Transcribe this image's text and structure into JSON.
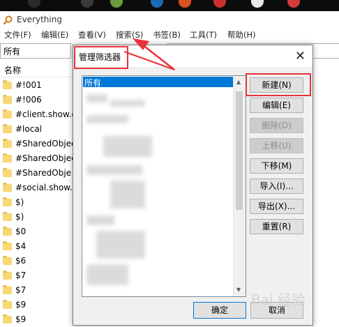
{
  "app": {
    "title": "Everything"
  },
  "menu": [
    "文件(F)",
    "编辑(E)",
    "查看(V)",
    "搜索(S)",
    "书签(B)",
    "工具(T)",
    "帮助(H)"
  ],
  "filter": {
    "current": "所有"
  },
  "list": {
    "header": "名称",
    "items": [
      "#!001",
      "#!006",
      "#client.show.q",
      "#local",
      "#SharedObjec",
      "#SharedObjec",
      "#SharedObje",
      "#social.show.q",
      "$)",
      "$)",
      "$0",
      "$4",
      "$6",
      "$7",
      "$7",
      "$9",
      "$9"
    ]
  },
  "dialog": {
    "title": "管理筛选器",
    "close_icon": "close-icon",
    "list_selected": "所有",
    "buttons": {
      "new": "新建(N)",
      "edit": "编辑(E)",
      "delete": "删除(D)",
      "move_up": "上移(U)",
      "move_down": "下移(M)",
      "import": "导入(I)...",
      "export": "导出(X)...",
      "reset": "重置(R)"
    },
    "ok": "确定",
    "cancel": "取消"
  },
  "annotation_color": "#e8323a",
  "watermark": "Bai 经验"
}
